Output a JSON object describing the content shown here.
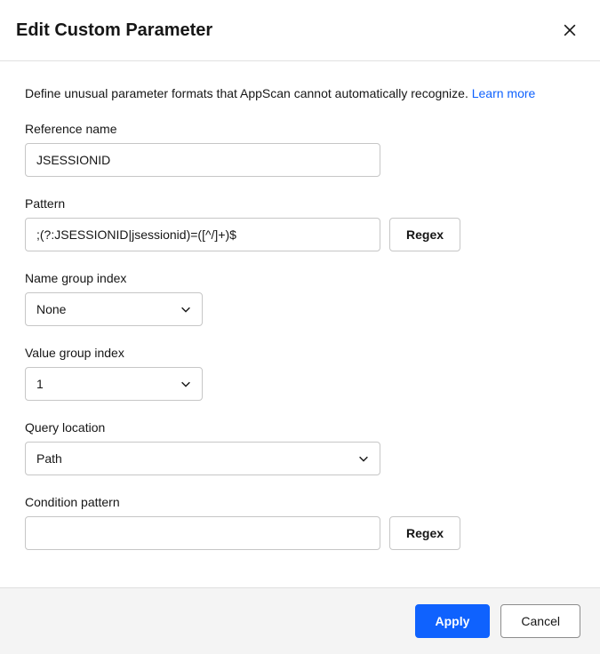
{
  "header": {
    "title": "Edit Custom Parameter"
  },
  "description": {
    "text": "Define unusual parameter formats that AppScan cannot automatically recognize. ",
    "learn_more": "Learn more"
  },
  "fields": {
    "reference_name": {
      "label": "Reference name",
      "value": "JSESSIONID"
    },
    "pattern": {
      "label": "Pattern",
      "value": ";(?:JSESSIONID|jsessionid)=([^/]+)$",
      "regex_btn": "Regex"
    },
    "name_group_index": {
      "label": "Name group index",
      "value": "None"
    },
    "value_group_index": {
      "label": "Value group index",
      "value": "1"
    },
    "query_location": {
      "label": "Query location",
      "value": "Path"
    },
    "condition_pattern": {
      "label": "Condition pattern",
      "value": "",
      "regex_btn": "Regex"
    }
  },
  "footer": {
    "apply": "Apply",
    "cancel": "Cancel"
  }
}
